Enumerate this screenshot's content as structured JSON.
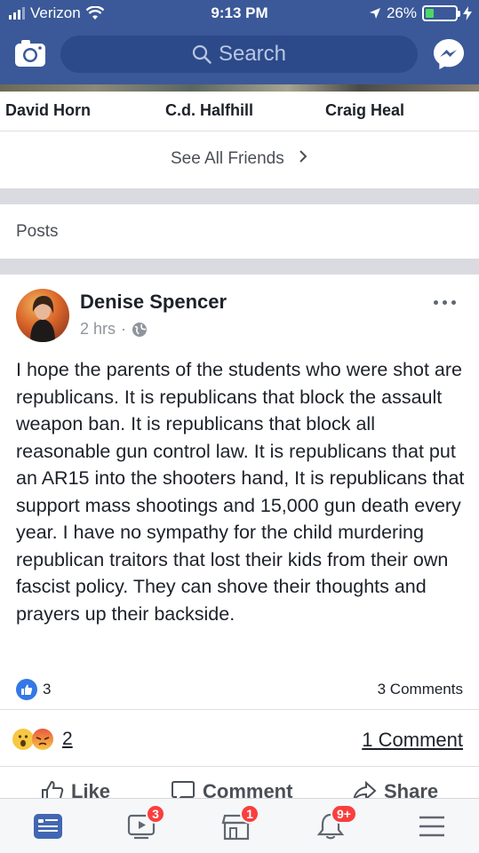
{
  "status_bar": {
    "carrier": "Verizon",
    "time": "9:13 PM",
    "battery": "26%",
    "battery_level": 0.26
  },
  "header": {
    "search_placeholder": "Search",
    "accent": "#3b5998"
  },
  "friends": {
    "names": [
      "David Horn",
      "C.d. Halfhill",
      "Craig Heal"
    ],
    "see_all_label": "See All Friends"
  },
  "posts_section": {
    "title": "Posts"
  },
  "post": {
    "author": "Denise Spencer",
    "time": "2 hrs",
    "text": "I hope the parents of the students who were shot are republicans. It is republicans that block the assault weapon ban. It is republicans that block all reasonable gun control law. It is republicans that put an AR15 into the shooters hand, It is republicans that support mass shootings and 15,000 gun death every year. I have no sympathy for the child murdering republican traitors that lost their kids from their own fascist policy. They can shove their thoughts and prayers up their backside.",
    "likes": "3",
    "comments": "3 Comments",
    "reactions_count": "2",
    "one_comment": "1 Comment",
    "actions": {
      "like": "Like",
      "comment": "Comment",
      "share": "Share"
    }
  },
  "tabbar": {
    "video_badge": "3",
    "marketplace_badge": "1",
    "notifications_badge": "9+",
    "active_color": "#4267b2"
  }
}
